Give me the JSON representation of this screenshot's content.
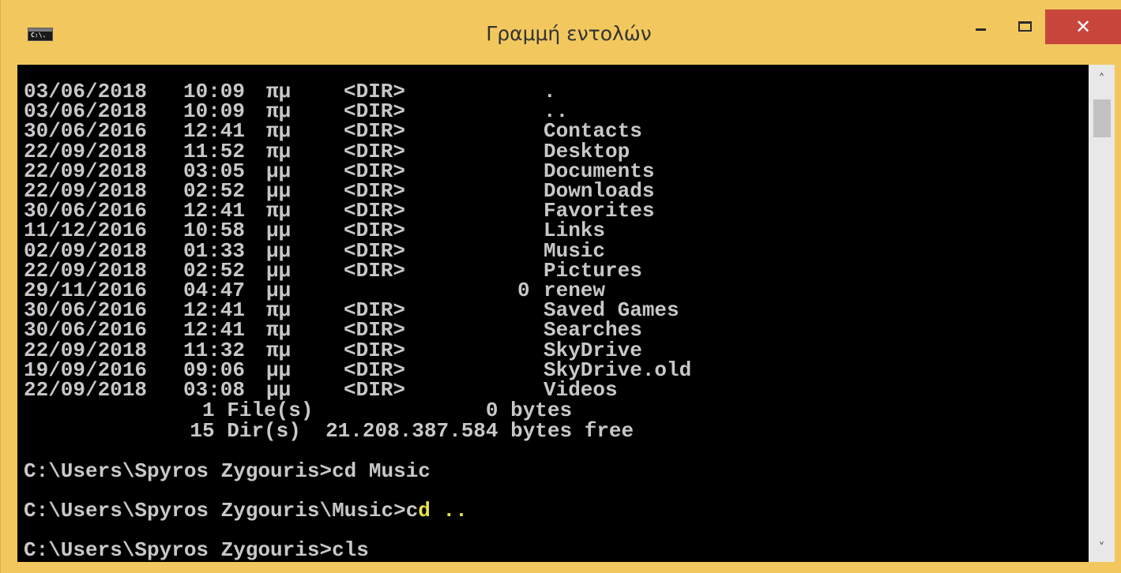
{
  "window": {
    "title": "Γραμμή εντολών",
    "icon_text": "C:\\.",
    "controls": {
      "minimize": "minimize-icon",
      "maximize": "maximize-icon",
      "close": "✕"
    }
  },
  "listing": [
    {
      "date": "03/06/2018",
      "time": "10:09",
      "ampm": "πμ",
      "dir": "<DIR>",
      "size": "",
      "name": "."
    },
    {
      "date": "03/06/2018",
      "time": "10:09",
      "ampm": "πμ",
      "dir": "<DIR>",
      "size": "",
      "name": ".."
    },
    {
      "date": "30/06/2016",
      "time": "12:41",
      "ampm": "πμ",
      "dir": "<DIR>",
      "size": "",
      "name": "Contacts"
    },
    {
      "date": "22/09/2018",
      "time": "11:52",
      "ampm": "πμ",
      "dir": "<DIR>",
      "size": "",
      "name": "Desktop"
    },
    {
      "date": "22/09/2018",
      "time": "03:05",
      "ampm": "μμ",
      "dir": "<DIR>",
      "size": "",
      "name": "Documents"
    },
    {
      "date": "22/09/2018",
      "time": "02:52",
      "ampm": "μμ",
      "dir": "<DIR>",
      "size": "",
      "name": "Downloads"
    },
    {
      "date": "30/06/2016",
      "time": "12:41",
      "ampm": "πμ",
      "dir": "<DIR>",
      "size": "",
      "name": "Favorites"
    },
    {
      "date": "11/12/2016",
      "time": "10:58",
      "ampm": "μμ",
      "dir": "<DIR>",
      "size": "",
      "name": "Links"
    },
    {
      "date": "02/09/2018",
      "time": "01:33",
      "ampm": "μμ",
      "dir": "<DIR>",
      "size": "",
      "name": "Music"
    },
    {
      "date": "22/09/2018",
      "time": "02:52",
      "ampm": "μμ",
      "dir": "<DIR>",
      "size": "",
      "name": "Pictures"
    },
    {
      "date": "29/11/2016",
      "time": "04:47",
      "ampm": "μμ",
      "dir": "",
      "size": "0",
      "name": "renew"
    },
    {
      "date": "30/06/2016",
      "time": "12:41",
      "ampm": "πμ",
      "dir": "<DIR>",
      "size": "",
      "name": "Saved Games"
    },
    {
      "date": "30/06/2016",
      "time": "12:41",
      "ampm": "πμ",
      "dir": "<DIR>",
      "size": "",
      "name": "Searches"
    },
    {
      "date": "22/09/2018",
      "time": "11:32",
      "ampm": "πμ",
      "dir": "<DIR>",
      "size": "",
      "name": "SkyDrive"
    },
    {
      "date": "19/09/2016",
      "time": "09:06",
      "ampm": "μμ",
      "dir": "<DIR>",
      "size": "",
      "name": "SkyDrive.old"
    },
    {
      "date": "22/09/2018",
      "time": "03:08",
      "ampm": "μμ",
      "dir": "<DIR>",
      "size": "",
      "name": "Videos"
    }
  ],
  "summary": {
    "files_line": "               1 File(s)              0 bytes",
    "dirs_line": "              15 Dir(s)  21.208.387.584 bytes free"
  },
  "prompts": [
    {
      "prompt": "C:\\Users\\Spyros Zygouris>",
      "command": "cd Music",
      "highlight": ""
    },
    {
      "prompt": "C:\\Users\\Spyros Zygouris\\Music>",
      "command": "c",
      "highlight": "d .."
    },
    {
      "prompt": "C:\\Users\\Spyros Zygouris>",
      "command": "cls",
      "highlight": ""
    }
  ],
  "colors": {
    "titlebar": "#f2c85e",
    "close": "#c9463d",
    "console_bg": "#000000",
    "console_fg": "#c8c8c8",
    "highlight": "#e6e24a"
  }
}
